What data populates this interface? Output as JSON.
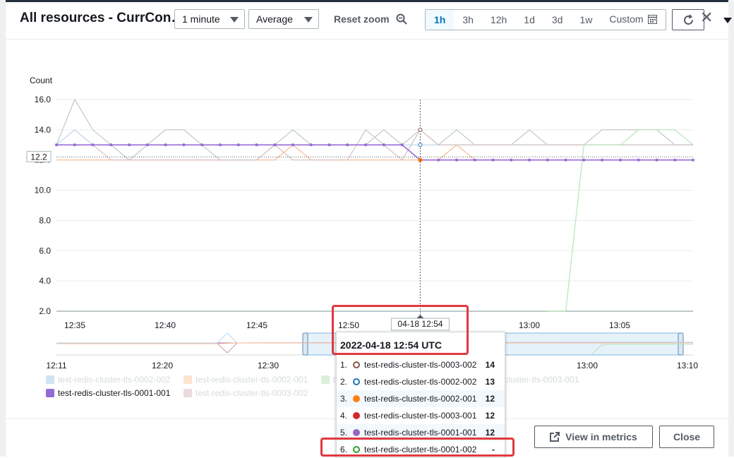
{
  "header": {
    "title": "All resources - CurrCon…",
    "period": "1 minute",
    "statistic": "Average",
    "reset_zoom": "Reset zoom",
    "ranges": [
      "1h",
      "3h",
      "12h",
      "1d",
      "3d",
      "1w",
      "Custom"
    ],
    "active_range": "1h"
  },
  "footer": {
    "view_in_metrics": "View in metrics",
    "close": "Close"
  },
  "colors": {
    "accent": "#0073bb",
    "highlight_box": "#e0393e",
    "series_purple": "#9469d6",
    "series_orange": "#ec7211",
    "series_green": "#2ca02c"
  },
  "chart_data": {
    "type": "line",
    "ylabel": "Count",
    "yticks": [
      "16.0",
      "14.0",
      "12.0",
      "10.0",
      "8.0",
      "6.0",
      "4.0",
      "2.0"
    ],
    "ylim": [
      2,
      16
    ],
    "x_labels": [
      "12:35",
      "12:40",
      "12:45",
      "12:50",
      "13:00",
      "13:05"
    ],
    "nav_labels": [
      "12:11",
      "12:20",
      "12:30",
      "13:00",
      "13:10"
    ],
    "crosshair_x": "04-18 12:54",
    "crosshair_y": "12.2",
    "series": [
      {
        "name": "test-redis-cluster-tls-0001-001",
        "color": "#9469d6",
        "values": [
          13,
          13,
          13,
          13,
          13,
          13,
          13,
          13,
          13,
          13,
          13,
          13,
          13,
          13,
          13,
          13,
          13,
          13,
          13,
          13,
          12,
          12,
          12,
          12,
          12,
          12,
          12,
          12,
          12,
          12,
          12,
          12,
          12,
          12,
          12,
          12
        ]
      },
      {
        "name": "test-redis-cluster-tls-0002-001",
        "color": "#f9b88f",
        "values": [
          12,
          12,
          12,
          12,
          12,
          12,
          12,
          12,
          12,
          12,
          12,
          12,
          12,
          13,
          12,
          12,
          12,
          12,
          12,
          12,
          12,
          12,
          13,
          12,
          12,
          12,
          12,
          12,
          12,
          12,
          12,
          12,
          12,
          12,
          12,
          12
        ]
      },
      {
        "name": "test-redis-cluster-tls-0002-002",
        "color": "#b7d7f0",
        "values": [
          13,
          14,
          13,
          13,
          13,
          13,
          13,
          13,
          13,
          13,
          13,
          13,
          13,
          13,
          13,
          13,
          13,
          13,
          13,
          13,
          13,
          13,
          13,
          13,
          13,
          13,
          13,
          13,
          13,
          13,
          13,
          13,
          13,
          13,
          13,
          13
        ]
      },
      {
        "name": "test-redis-cluster-tls-0003-001",
        "color": "#bfc8c8",
        "values": [
          13,
          16,
          14,
          13,
          12,
          13,
          14,
          14,
          13,
          12,
          12,
          12,
          13,
          14,
          13,
          13,
          13,
          13,
          14,
          13,
          14,
          13,
          14,
          13,
          13,
          13,
          14,
          13,
          13,
          13,
          14,
          14,
          14,
          14,
          13,
          13
        ]
      },
      {
        "name": "test-redis-cluster-tls-0003-002",
        "color": "#d4c1c1",
        "values": [
          13,
          13,
          13,
          12,
          12,
          12,
          12,
          12,
          12,
          12,
          12,
          12,
          13,
          12,
          12,
          12,
          12,
          14,
          13,
          12,
          14,
          13,
          13,
          13,
          13,
          13,
          13,
          13,
          13,
          13,
          13,
          13,
          13,
          13,
          13,
          13
        ]
      },
      {
        "name": "test-redis-cluster-tls-0001-002",
        "color": "#b9e5b9",
        "values": [
          null,
          null,
          null,
          null,
          null,
          null,
          null,
          null,
          null,
          null,
          null,
          null,
          null,
          null,
          null,
          null,
          null,
          null,
          null,
          null,
          null,
          null,
          null,
          null,
          null,
          null,
          null,
          2,
          2,
          13,
          13,
          13,
          14,
          14,
          14,
          13
        ]
      }
    ],
    "legend": [
      {
        "label": "test-redis-cluster-tls-0002-002",
        "color": "#cfe3f5",
        "muted": true
      },
      {
        "label": "test-redis-cluster-tls-0002-001",
        "color": "#fde3d0",
        "muted": true
      },
      {
        "label": "t",
        "color": "#d9efd9",
        "muted": true
      },
      {
        "label": "test-redis-cluster-tls-0003-001",
        "color": "#e2e5e6",
        "muted": true
      },
      {
        "label": "test-redis-cluster-tls-0001-001",
        "color": "#9469d6",
        "muted": false
      },
      {
        "label": "test-redis-cluster-tls-0003-002",
        "color": "#ebdcdc",
        "muted": true
      }
    ]
  },
  "tooltip": {
    "title": "2022-04-18 12:54 UTC",
    "rows": [
      {
        "n": "1.",
        "label": "test-redis-cluster-tls-0003-002",
        "value": "14",
        "color": "#8c564b",
        "filled": false
      },
      {
        "n": "2.",
        "label": "test-redis-cluster-tls-0002-002",
        "value": "13",
        "color": "#1f77b4",
        "filled": false
      },
      {
        "n": "3.",
        "label": "test-redis-cluster-tls-0002-001",
        "value": "12",
        "color": "#ff7f0e",
        "filled": true
      },
      {
        "n": "4.",
        "label": "test-redis-cluster-tls-0003-001",
        "value": "12",
        "color": "#d62728",
        "filled": true
      },
      {
        "n": "5.",
        "label": "test-redis-cluster-tls-0001-001",
        "value": "12",
        "color": "#9467bd",
        "filled": true
      },
      {
        "n": "6.",
        "label": "test-redis-cluster-tls-0001-002",
        "value": "-",
        "color": "#2ca02c",
        "filled": false
      }
    ]
  }
}
